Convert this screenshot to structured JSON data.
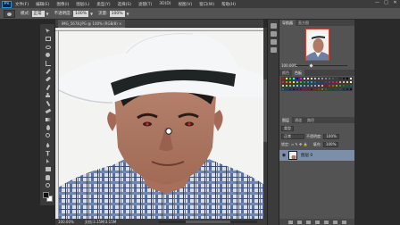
{
  "app": {
    "logo": "Ps"
  },
  "menu": [
    "文件(F)",
    "编辑(E)",
    "图像(I)",
    "图层(L)",
    "类型(Y)",
    "选择(S)",
    "滤镜(T)",
    "3D(D)",
    "视图(V)",
    "窗口(W)",
    "帮助(H)"
  ],
  "window_controls": [
    "—",
    "□",
    "✕"
  ],
  "options": {
    "mode_label": "模式:",
    "mode_value": "正常",
    "opacity_label": "不透明度:",
    "opacity_value": "100%",
    "flow_label": "流量:",
    "flow_value": "100%"
  },
  "document": {
    "tab_title": "IMG_5678.JPG @ 100% (RGB/8) ×"
  },
  "statusbar": {
    "zoom": "100.00%",
    "doc_info": "文档:3.15M/3.15M"
  },
  "navigator": {
    "tabs": [
      "导航器",
      "直方图"
    ],
    "zoom": "100.00%"
  },
  "swatches": {
    "tabs": [
      "颜色",
      "色板"
    ],
    "colors": [
      "#ff0000",
      "#ffff00",
      "#00ff00",
      "#00ffff",
      "#0000ff",
      "#ff00ff",
      "#ffffff",
      "#ebebeb",
      "#d6d6d6",
      "#c0c0c0",
      "#aaaaaa",
      "#959595",
      "#808080",
      "#6b6b6b",
      "#555555",
      "#404040",
      "#2b2b2b",
      "#151515",
      "#000000",
      "#ffffff",
      "#ee1d24",
      "#f26522",
      "#f7941d",
      "#fff200",
      "#8dc63f",
      "#39b54a",
      "#00a651",
      "#00a99d",
      "#00aeef",
      "#0072bc",
      "#0054a6",
      "#2e3192",
      "#662d91",
      "#92278f",
      "#ec008c",
      "#ed145b",
      "#f69679",
      "#f9ad81",
      "#fdc689",
      "#fff799",
      "#c4df9b",
      "#a3d39c",
      "#82ca9c",
      "#7accc8",
      "#6dcff6",
      "#7da7d9",
      "#8393ca",
      "#8781bd",
      "#a187be",
      "#bd8cbf",
      "#f49ac1",
      "#f5989d",
      "#9e0b0f",
      "#a0410d",
      "#a36209",
      "#aba000",
      "#598527",
      "#1a7b30",
      "#007236",
      "#00746b",
      "#0076a3",
      "#004b80",
      "#003471",
      "#1b1464",
      "#440e62",
      "#630460",
      "#9e005d",
      "#9e0039",
      "#790000",
      "#7b2e00",
      "#7d4900",
      "#827b00",
      "#406618",
      "#005e20",
      "#005826",
      "#005952",
      "#005b7f",
      "#003663",
      "#002157",
      "#0d004c"
    ]
  },
  "layers": {
    "tabs": [
      "图层",
      "通道",
      "路径"
    ],
    "filter_label": "类型",
    "blend_mode": "正常",
    "opacity_label": "不透明度:",
    "opacity_value": "100%",
    "lock_label": "锁定:",
    "fill_label": "填充:",
    "fill_value": "100%",
    "items": [
      {
        "name": "图层 0",
        "visible": true
      }
    ]
  }
}
